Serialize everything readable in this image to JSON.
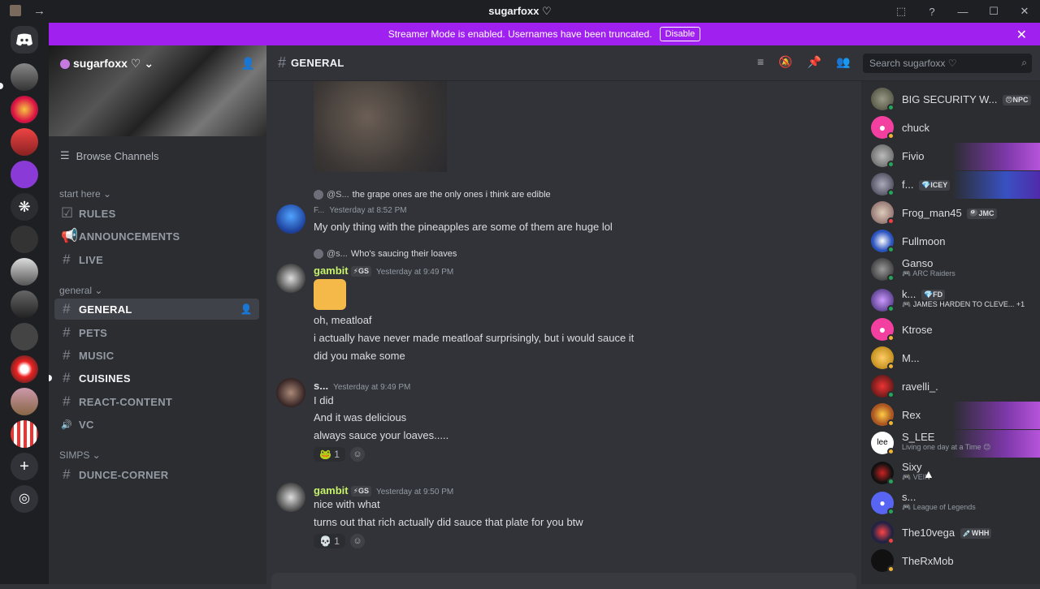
{
  "titlebar": {
    "title": "sugarfoxx ♡",
    "back": "←",
    "forward": "→",
    "controls": [
      "⬚",
      "?",
      "—",
      "☐",
      "✕"
    ]
  },
  "banner": {
    "text": "Streamer Mode is enabled. Usernames have been truncated.",
    "button": "Disable",
    "close": "✕"
  },
  "server": {
    "name": "sugarfoxx ♡",
    "browse": "Browse Channels",
    "categories": [
      {
        "name": "start here",
        "channels": [
          {
            "name": "RULES",
            "icon": "☑"
          },
          {
            "name": "ANNOUNCEMENTS",
            "icon": "📢"
          },
          {
            "name": "LIVE",
            "icon": "#"
          }
        ]
      },
      {
        "name": "general",
        "channels": [
          {
            "name": "GENERAL",
            "icon": "#"
          },
          {
            "name": "PETS",
            "icon": "#"
          },
          {
            "name": "MUSIC",
            "icon": "#"
          },
          {
            "name": "CUISINES",
            "icon": "#"
          },
          {
            "name": "REACT-CONTENT",
            "icon": "#"
          },
          {
            "name": "VC",
            "icon": "🔊"
          }
        ]
      },
      {
        "name": "SIMPS",
        "channels": [
          {
            "name": "DUNCE-CORNER",
            "icon": "#"
          }
        ]
      }
    ]
  },
  "chat": {
    "channel": "GENERAL",
    "search_placeholder": "Search sugarfoxx ♡",
    "messages": [
      {
        "reply_user": "@S...",
        "reply_text": "the grape ones are the only ones i think are edible",
        "user": "F...",
        "time": "Yesterday at 8:52 PM",
        "lines": [
          "My only thing with the pineapples are some of them are huge lol"
        ]
      },
      {
        "reply_user": "@s...",
        "reply_text": "Who's saucing their loaves",
        "user": "gambit",
        "tag": "⚡GS",
        "time": "Yesterday at 9:49 PM",
        "lines": [
          "oh, meatloaf",
          "i actually have never made meatloaf surprisingly, but i would sauce it",
          "did you make some"
        ]
      },
      {
        "user": "s...",
        "time": "Yesterday at 9:49 PM",
        "lines": [
          "I did",
          "And it was delicious",
          "always sauce your loaves....."
        ],
        "reaction": "🐸",
        "reaction_count": "1"
      },
      {
        "user": "gambit",
        "tag": "⚡GS",
        "time": "Yesterday at 9:50 PM",
        "lines": [
          "nice with what",
          "turns out that rich actually did sauce that plate for you btw"
        ],
        "reaction": "💀",
        "reaction_count": "1"
      }
    ]
  },
  "members": [
    {
      "name": "BIG SECURITY W...",
      "tag": "😠NPC",
      "status": "online"
    },
    {
      "name": "chuck",
      "status": "idle"
    },
    {
      "name": "Fivio",
      "status": "online"
    },
    {
      "name": "f...",
      "tag": "💎ICEY",
      "status": "online"
    },
    {
      "name": "Frog_man45",
      "tag": "🎱JMC",
      "status": "dnd"
    },
    {
      "name": "Fullmoon",
      "status": "online"
    },
    {
      "name": "Ganso",
      "sub": "🎮 ARC Raiders",
      "status": "online"
    },
    {
      "name": "k...",
      "tag": "💎FD",
      "sub": "🎮 JAMES HARDEN TO CLEVE... +1",
      "status": "online"
    },
    {
      "name": "Ktrose",
      "status": "idle"
    },
    {
      "name": "M...",
      "status": "idle"
    },
    {
      "name": "ravelli_.",
      "status": "online"
    },
    {
      "name": "Rex",
      "status": "idle"
    },
    {
      "name": "S_LEE",
      "sub": "Living one day at a Time 😊",
      "status": "idle"
    },
    {
      "name": "Sixy",
      "sub": "🎮 VEIN",
      "status": "online"
    },
    {
      "name": "s...",
      "sub": "🎮 League of Legends",
      "status": "online"
    },
    {
      "name": "The10vega",
      "tag": "💉WHH",
      "status": "dnd"
    },
    {
      "name": "TheRxMob",
      "status": "idle"
    }
  ]
}
